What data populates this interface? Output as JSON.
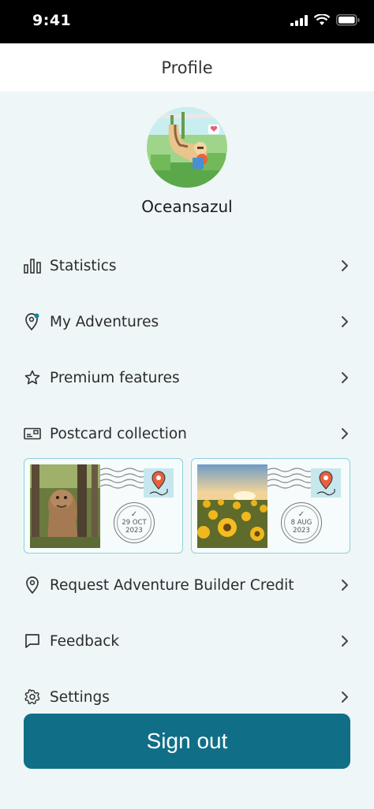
{
  "status_bar": {
    "time": "9:41"
  },
  "header": {
    "title": "Profile"
  },
  "profile": {
    "username": "Oceansazul"
  },
  "menu": [
    {
      "label": "Statistics",
      "icon": "bar-chart-icon"
    },
    {
      "label": "My Adventures",
      "icon": "location-pin-icon"
    },
    {
      "label": "Premium features",
      "icon": "star-icon"
    },
    {
      "label": "Postcard collection",
      "icon": "postcard-icon"
    },
    {
      "label": "Request Adventure Builder Credit",
      "icon": "location-pin-icon"
    },
    {
      "label": "Feedback",
      "icon": "speech-bubble-icon"
    },
    {
      "label": "Settings",
      "icon": "gear-icon"
    }
  ],
  "postcards": [
    {
      "date": "29 OCT",
      "year": "2023",
      "photo": "troll-statue-forest"
    },
    {
      "date": "8 AUG",
      "year": "2023",
      "photo": "sunflower-field"
    }
  ],
  "sign_out_label": "Sign out",
  "colors": {
    "accent": "#106f87",
    "background": "#eef6f7",
    "postcard_border": "#8fd0db",
    "pin": "#e8603c"
  }
}
